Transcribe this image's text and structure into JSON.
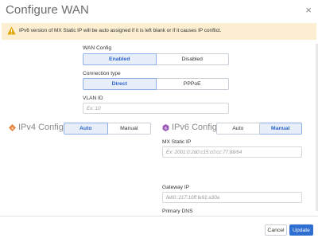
{
  "modal": {
    "title": "Configure WAN",
    "close_icon": "close-icon"
  },
  "warning": {
    "icon": "warning-triangle-icon",
    "text": "IPv6 version of MX Static IP will be auto assigned if it is left blank or if it causes IP conflict."
  },
  "wan_config": {
    "label": "WAN Config",
    "options": [
      "Enabled",
      "Disabled"
    ],
    "selected": "Enabled"
  },
  "connection_type": {
    "label": "Connection type",
    "options": [
      "Direct",
      "PPPoE"
    ],
    "selected": "Direct"
  },
  "vlan": {
    "label": "VLAN ID",
    "placeholder": "Ex: 10",
    "value": ""
  },
  "ipv4": {
    "title": "IPv4 Config",
    "icon": "ipv4-badge-icon",
    "options": [
      "Auto",
      "Manual"
    ],
    "selected": "Auto"
  },
  "ipv6": {
    "title": "IPv6 Config",
    "icon": "ipv6-badge-icon",
    "options": [
      "Auto",
      "Manual"
    ],
    "selected": "Manual",
    "static_ip_label": "MX Static IP",
    "static_ip_placeholder": "Ex: 2001:0:2d0:c15:c0:cc:77:88/64",
    "gateway_label": "Gateway IP",
    "gateway_placeholder": "fe80::217:10ff:fe91:a30a",
    "dns_label": "Primary DNS"
  },
  "footer": {
    "cancel_label": "Cancel",
    "update_label": "Update"
  },
  "colors": {
    "accent": "#2f6fd1",
    "warning_bg": "#fbeed1",
    "ipv4_icon": "#e8833a",
    "ipv6_icon": "#9b59b6"
  }
}
